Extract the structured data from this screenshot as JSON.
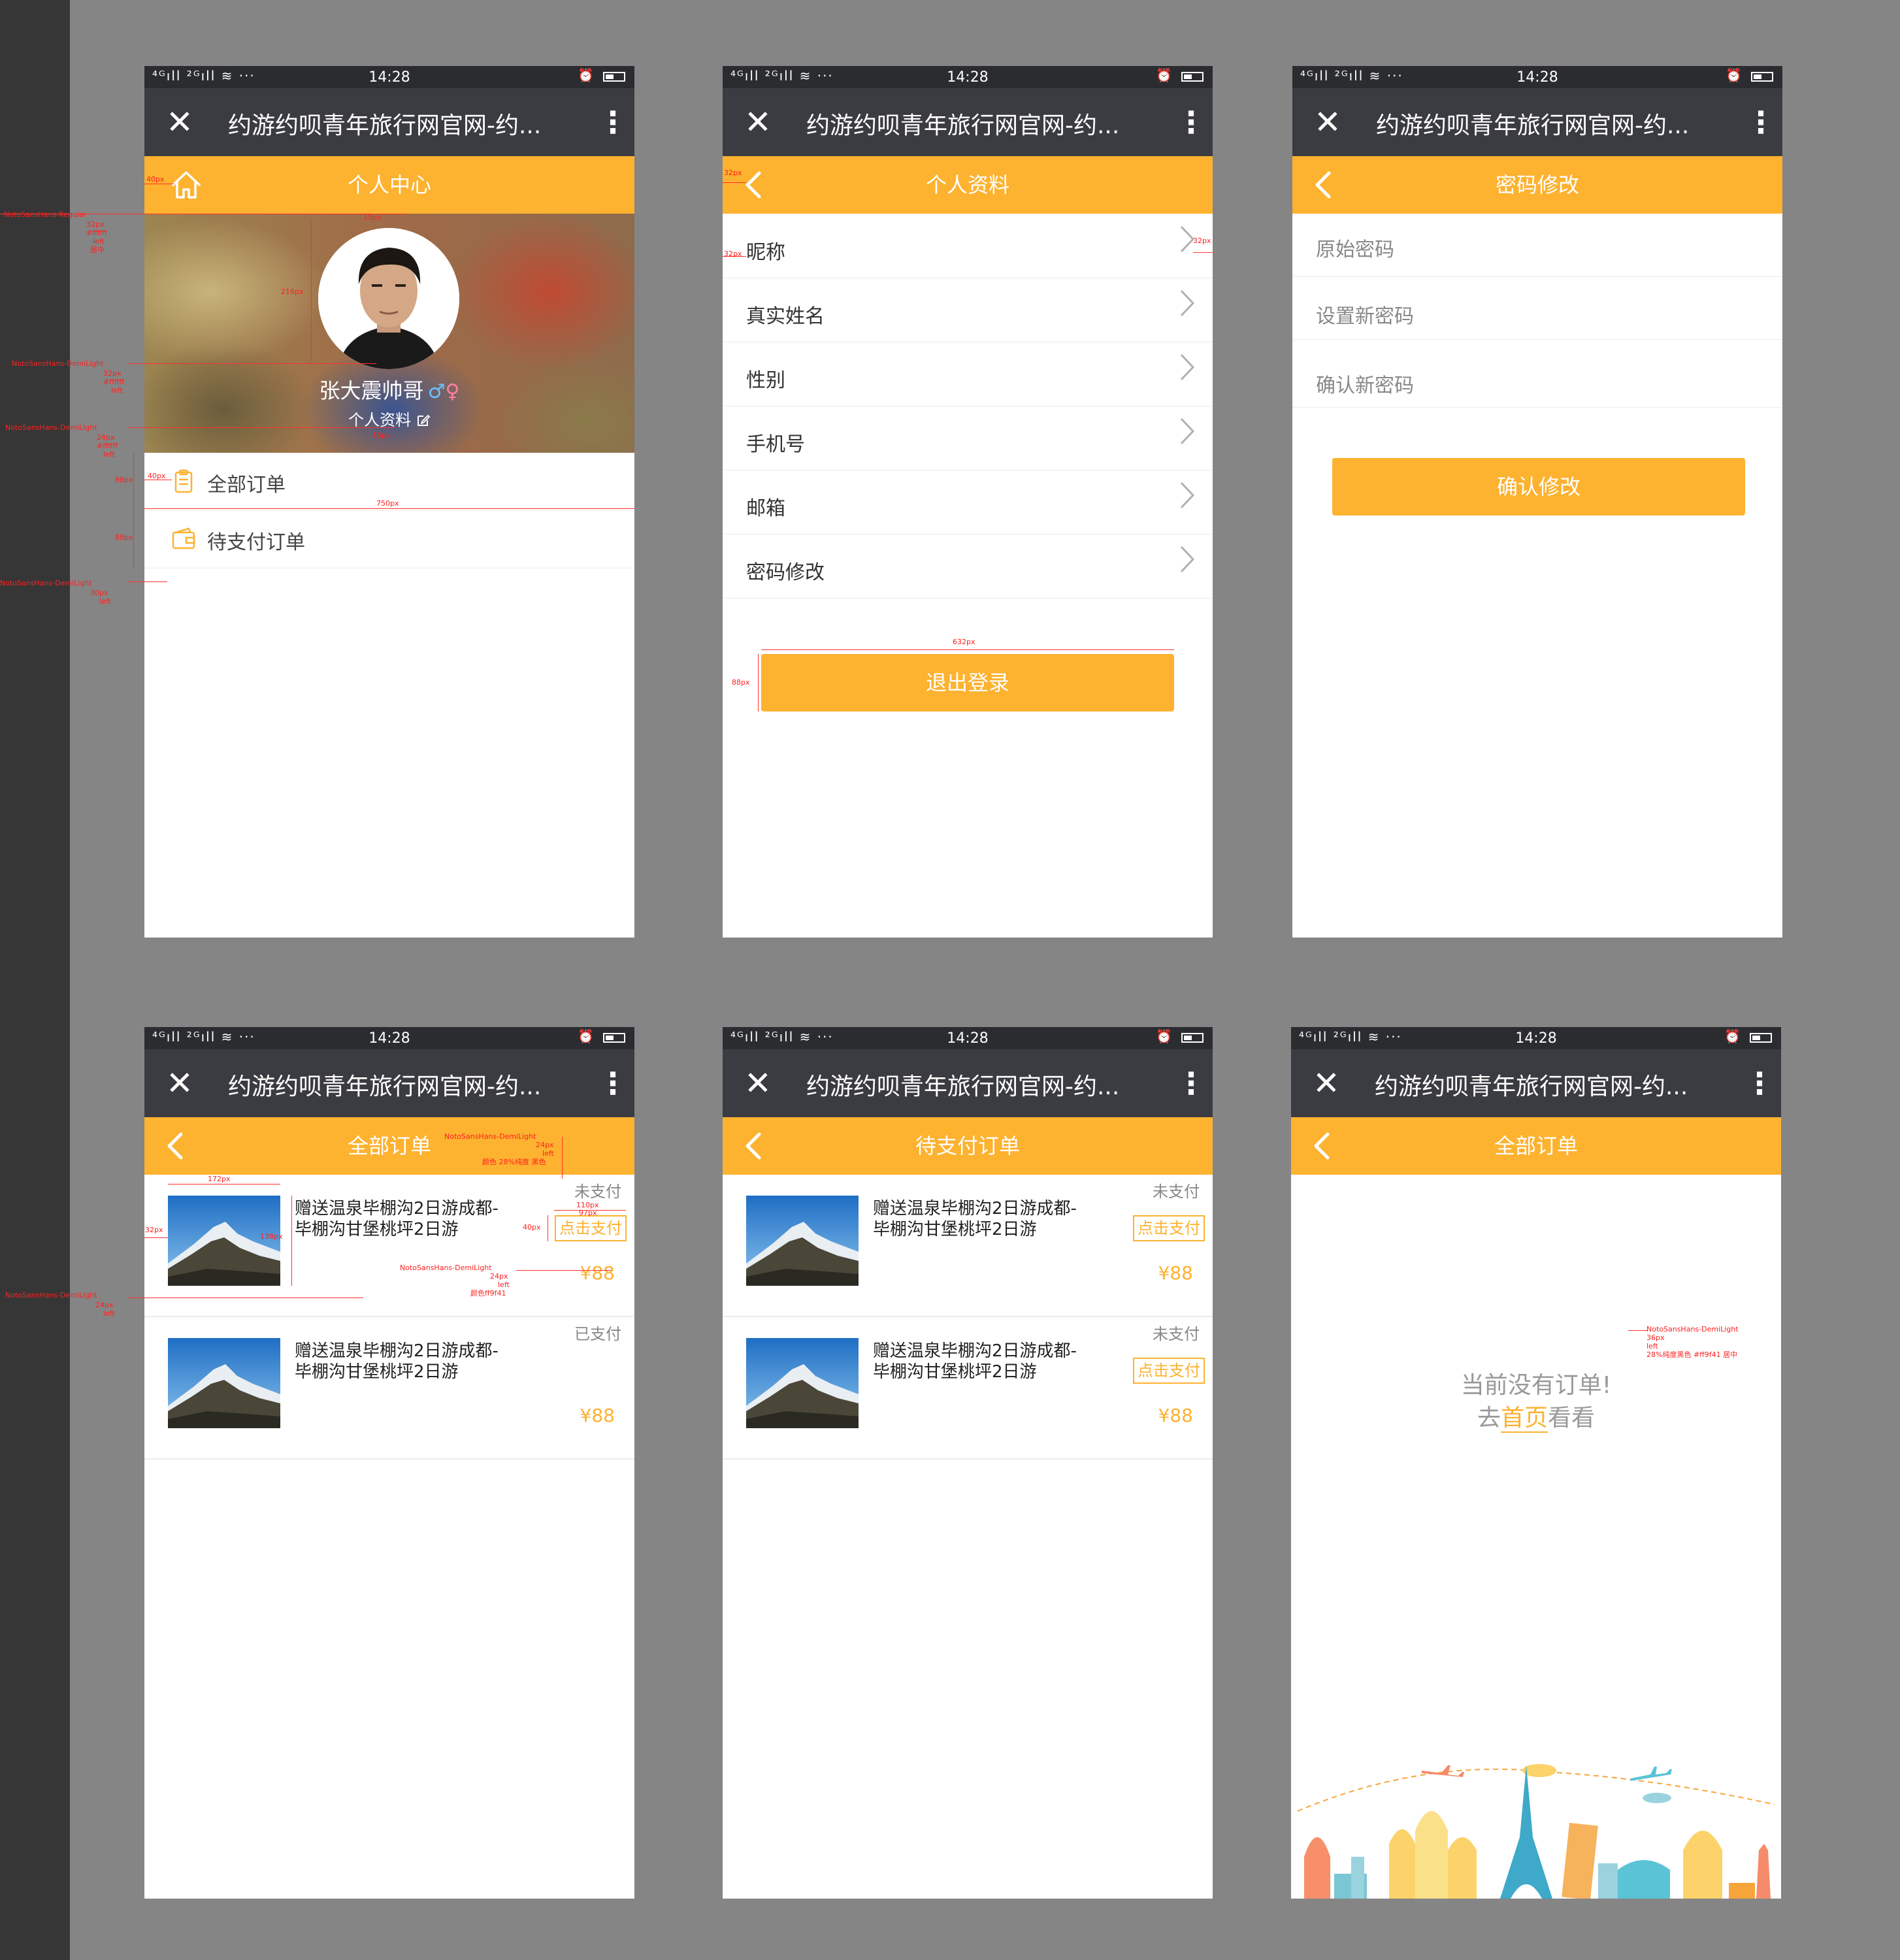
{
  "statusbar": {
    "time": "14:28",
    "signal": "⁴ᴳıll ²ᴳıll ≋ ···",
    "alarm": "⏰"
  },
  "browser": {
    "title": "约游约呗青年旅行网官网-约...",
    "close_icon": "close-icon",
    "more_icon": "more-vert-icon"
  },
  "colors": {
    "accent": "#fdb230",
    "dark_bar": "#2b2c30",
    "title_bar": "#3b3c41"
  },
  "profile": {
    "header_title": "个人中心",
    "username": "张大震帅哥",
    "gender_male": "♂",
    "gender_female": "♀",
    "profile_link": "个人资料",
    "menu": [
      {
        "label": "全部订单",
        "icon": "clipboard-icon"
      },
      {
        "label": "待支付订单",
        "icon": "wallet-icon"
      }
    ]
  },
  "personal_info": {
    "header_title": "个人资料",
    "rows": [
      "昵称",
      "真实姓名",
      "性别",
      "手机号",
      "邮箱",
      "密码修改"
    ],
    "logout": "退出登录"
  },
  "password": {
    "header_title": "密码修改",
    "fields": [
      "原始密码",
      "设置新密码",
      "确认新密码"
    ],
    "confirm": "确认修改"
  },
  "all_orders": {
    "header_title": "全部订单",
    "orders": [
      {
        "name": "赠送温泉毕棚沟2日游成都-毕棚沟甘堡桃坪2日游",
        "status": "未支付",
        "pay": "点击支付",
        "price": "¥88"
      },
      {
        "name": "赠送温泉毕棚沟2日游成都-毕棚沟甘堡桃坪2日游",
        "status": "已支付",
        "price": "¥88"
      }
    ]
  },
  "pending_orders": {
    "header_title": "待支付订单",
    "orders": [
      {
        "name": "赠送温泉毕棚沟2日游成都-毕棚沟甘堡桃坪2日游",
        "status": "未支付",
        "pay": "点击支付",
        "price": "¥88"
      },
      {
        "name": "赠送温泉毕棚沟2日游成都-毕棚沟甘堡桃坪2日游",
        "status": "未支付",
        "pay": "点击支付",
        "price": "¥88"
      }
    ]
  },
  "empty_orders": {
    "header_title": "全部订单",
    "line1": "当前没有订单!",
    "line2_pre": "去",
    "line2_link": "首页",
    "line2_post": "看看"
  },
  "annotations": {
    "profile": {
      "a1": "40px",
      "a2": "15px",
      "a3": "216px",
      "a4": "15px",
      "a5": "88px",
      "a6": "40px",
      "a7": "750px",
      "a8": "88px",
      "f1": [
        "NotoSansHans-Regular",
        "32px",
        "#ffffff",
        "left",
        "居中"
      ],
      "f2": [
        "NotoSansHans-DemiLight",
        "32px",
        "#ffffff",
        "left"
      ],
      "f3": [
        "NotoSansHans-DemiLight",
        "24px",
        "#ffffff",
        "left"
      ],
      "f4": [
        "NotoSansHans-DemiLight",
        "30px",
        "left"
      ]
    },
    "info": {
      "a1": "32px",
      "a2": "32px",
      "a3": "32px",
      "a4": "632px",
      "a5": "88px"
    },
    "orders": {
      "a1": "172px",
      "a2": "32px",
      "a3": "138px",
      "a4": "40px",
      "a5": "110px",
      "a6": "97px",
      "f1": [
        "NotoSansHans-DemiLight",
        "24px",
        "left",
        "颜色 28%纯度 黑色"
      ],
      "f2": [
        "NotoSansHans-DemiLight",
        "24px",
        "left",
        "颜色ff9f41"
      ],
      "f3": [
        "NotoSansHans-DemiLight",
        "24px",
        "left"
      ]
    },
    "empty": {
      "f1": [
        "NotoSansHans-DemiLight",
        "36px",
        "left",
        "28%纯度黑色  #ff9f41 居中"
      ]
    }
  }
}
